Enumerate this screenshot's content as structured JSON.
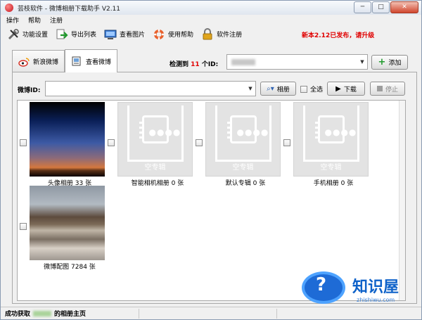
{
  "window": {
    "title": "芸枝软件 - 微博相册下载助手 V2.11",
    "min": "─",
    "max": "□",
    "close": "✕"
  },
  "menu": [
    "操作",
    "帮助",
    "注册"
  ],
  "toolbar": {
    "items": [
      {
        "label": "功能设置",
        "icon": "tools-icon"
      },
      {
        "label": "导出列表",
        "icon": "export-icon"
      },
      {
        "label": "查看图片",
        "icon": "monitor-icon"
      },
      {
        "label": "使用帮助",
        "icon": "lifebuoy-icon"
      },
      {
        "label": "软件注册",
        "icon": "lock-icon"
      }
    ],
    "upgrade_notice": "新本2.12已发布，请升级"
  },
  "tabs": [
    {
      "label": "新浪微博",
      "icon": "weibo-icon",
      "active": false
    },
    {
      "label": "查看微博",
      "icon": "album-icon",
      "active": true
    }
  ],
  "detect": {
    "prefix": "检测到",
    "count": "11",
    "suffix": "个ID:"
  },
  "id_combo": {
    "value": "",
    "arrow": "▼"
  },
  "add_button": "添加",
  "weibo": {
    "label": "微博ID:",
    "value": "",
    "arrow": "▼"
  },
  "album_button": "相册",
  "select_all": "全选",
  "download_button": "下载",
  "stop_button": "停止",
  "albums": [
    {
      "caption": "头像相册 33 张",
      "type": "photo-sky"
    },
    {
      "caption": "智能相机相册 0 张",
      "type": "empty",
      "empty_label": "空专辑"
    },
    {
      "caption": "默认专辑 0 张",
      "type": "empty",
      "empty_label": "空专辑"
    },
    {
      "caption": "手机相册 0 张",
      "type": "empty",
      "empty_label": "空专辑"
    },
    {
      "caption": "微博配图 7284 张",
      "type": "photo-temple"
    }
  ],
  "status": {
    "prefix": "成功获取",
    "suffix": "的相册主页"
  },
  "watermark": {
    "text": "知识屋",
    "url": "zhishiwu.com",
    "mark": "?"
  },
  "colors": {
    "accent_red": "#e00000",
    "watermark_blue": "#1e6bd6"
  }
}
